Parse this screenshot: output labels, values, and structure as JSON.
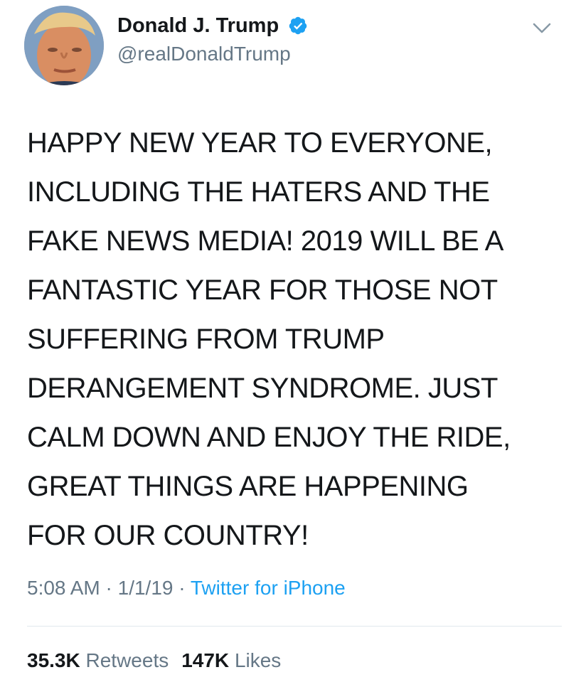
{
  "author": {
    "display_name": "Donald J. Trump",
    "handle": "@realDonaldTrump",
    "verified": true,
    "avatar_icon": "profile-photo",
    "verified_icon": "verified-badge-icon"
  },
  "menu_icon": "chevron-down-icon",
  "tweet": {
    "text": "HAPPY NEW YEAR TO EVERYONE,\nINCLUDING THE HATERS AND THE\nFAKE NEWS MEDIA! 2019 WILL BE A\nFANTASTIC YEAR FOR THOSE NOT\nSUFFERING FROM TRUMP\nDERANGEMENT SYNDROME. JUST\nCALM DOWN AND ENJOY THE RIDE,\nGREAT THINGS ARE HAPPENING\nFOR OUR COUNTRY!",
    "time": "5:08 AM",
    "separator": "·",
    "date": "1/1/19",
    "source": "Twitter for iPhone"
  },
  "stats": {
    "retweets_count": "35.3K",
    "retweets_label": "Retweets",
    "likes_count": "147K",
    "likes_label": "Likes"
  },
  "colors": {
    "text": "#14171a",
    "secondary": "#657786",
    "link": "#1da1f2",
    "divider": "#e1e8ed"
  }
}
